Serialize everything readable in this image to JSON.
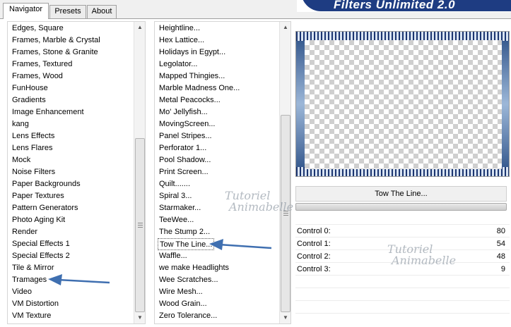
{
  "tabs": [
    "Navigator",
    "Presets",
    "About"
  ],
  "banner_title": "Filters Unlimited 2.0",
  "categories": [
    "Edges, Square",
    "Frames, Marble & Crystal",
    "Frames, Stone & Granite",
    "Frames, Textured",
    "Frames, Wood",
    "FunHouse",
    "Gradients",
    "Image Enhancement",
    "kang",
    "Lens Effects",
    "Lens Flares",
    "Mock",
    "Noise Filters",
    "Paper Backgrounds",
    "Paper Textures",
    "Pattern Generators",
    "Photo Aging Kit",
    "Render",
    "Special Effects 1",
    "Special Effects 2",
    "Tile & Mirror",
    "Tramages",
    "Video",
    "VM Distortion",
    "VM Texture"
  ],
  "filters": [
    "Heightline...",
    "Hex Lattice...",
    "Holidays in Egypt...",
    "Legolator...",
    "Mapped Thingies...",
    "Marble Madness One...",
    "Metal Peacocks...",
    "Mo' Jellyfish...",
    "MovingScreen...",
    "Panel Stripes...",
    "Perforator 1...",
    "Pool Shadow...",
    "Print Screen...",
    "Quilt.......",
    "Spiral 3...",
    "Starmaker...",
    "TeeWee...",
    "The Stump 2...",
    "Tow The Line...",
    "Waffle...",
    "we make Headlights",
    "Wee Scratches...",
    "Wire Mesh...",
    "Wood Grain...",
    "Zero Tolerance..."
  ],
  "selected_filter_name": "Tow The Line...",
  "controls": [
    {
      "label": "Control 0:",
      "value": "80"
    },
    {
      "label": "Control 1:",
      "value": "54"
    },
    {
      "label": "Control 2:",
      "value": "48"
    },
    {
      "label": "Control 3:",
      "value": "9"
    }
  ],
  "watermark": {
    "line1": "Tutoriel",
    "line2": "Animabelle"
  },
  "colors": {
    "banner": "#1e3c82",
    "arrow": "#3f6fb0"
  }
}
